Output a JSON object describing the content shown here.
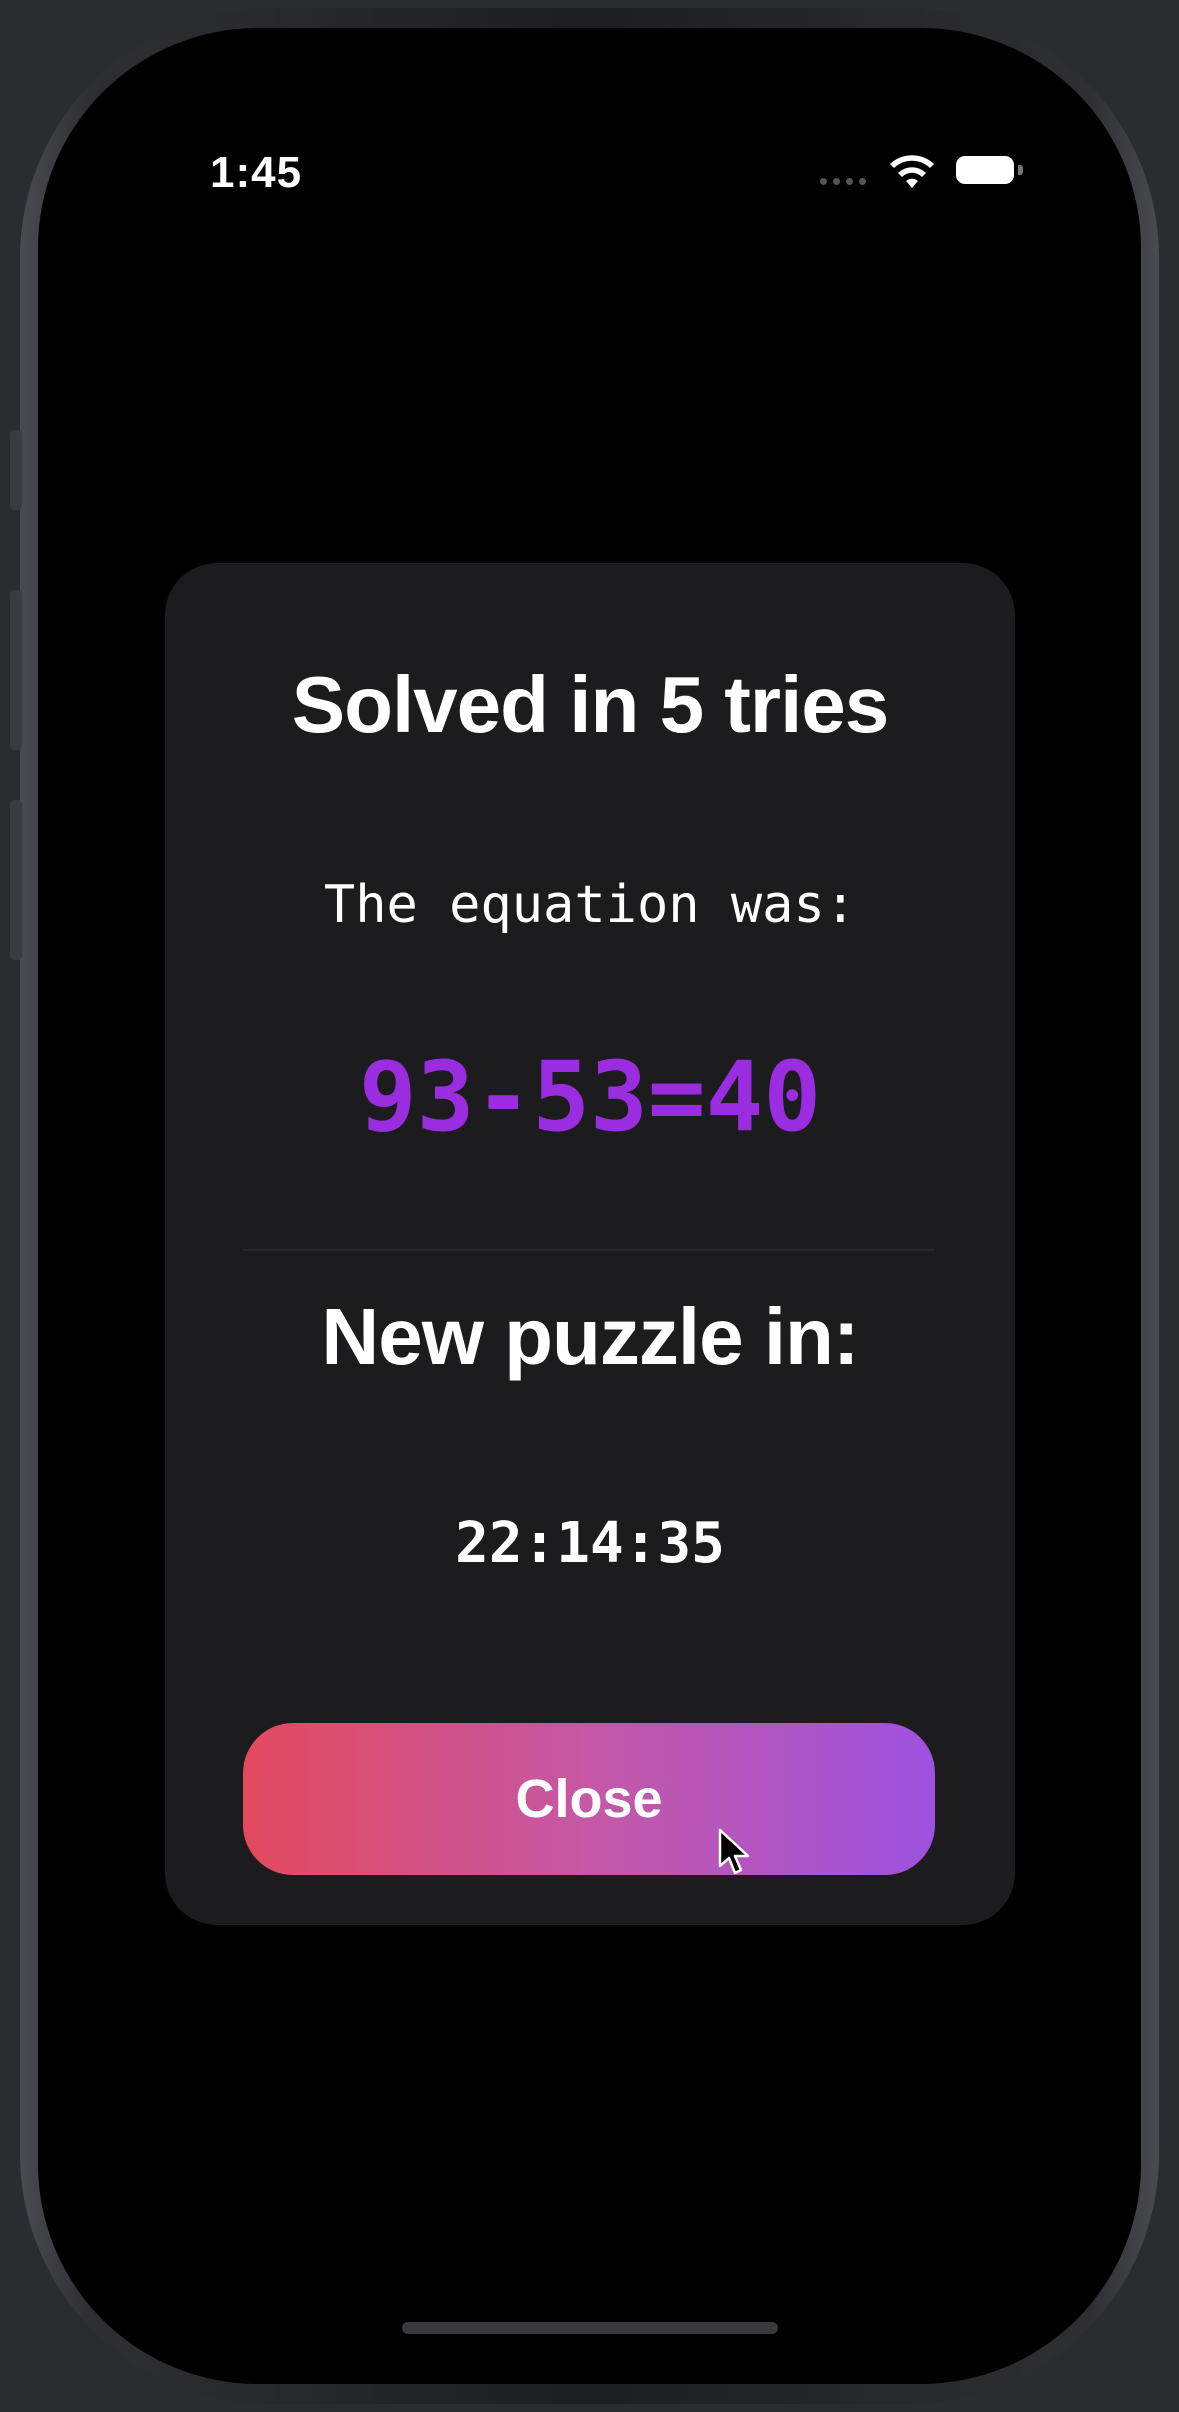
{
  "status_bar": {
    "time": "1:45",
    "icons": [
      "cellular-icon",
      "wifi-icon",
      "battery-icon"
    ]
  },
  "result_card": {
    "title": "Solved in 5 tries",
    "equation_label": "The equation was:",
    "equation": "93-53=40",
    "countdown_title": "New puzzle in:",
    "countdown": "22:14:35",
    "close_label": "Close"
  },
  "colors": {
    "equation": "#9b2de0",
    "button_gradient_start": "#e34a5f",
    "button_gradient_end": "#9d52df",
    "card_background": "#1c1c1e"
  }
}
